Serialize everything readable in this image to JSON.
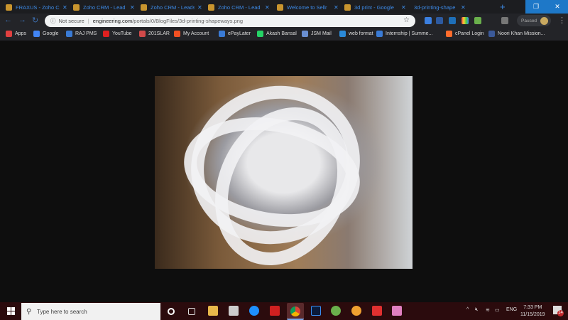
{
  "browser": {
    "tabs": [
      {
        "label": "FRAXUS - Zoho C",
        "icon": "fraxus-icon"
      },
      {
        "label": "Zoho CRM - Lead",
        "icon": "zoho-icon"
      },
      {
        "label": "Zoho CRM - Leads",
        "icon": "zoho-icon"
      },
      {
        "label": "Zoho CRM - Lead",
        "icon": "zoho-icon"
      },
      {
        "label": "Welcome to Sellr",
        "icon": "gmail-icon"
      },
      {
        "label": "3d print - Google",
        "icon": "google-icon"
      },
      {
        "label": "3d-printing-shape",
        "icon": "none",
        "active": true
      }
    ],
    "security": "Not secure",
    "url_domain": "engineering.com",
    "url_path": "/portals/0/BlogFiles/3d-printing-shapeways.png",
    "profile": "Paused",
    "bookmarks": [
      {
        "label": "Apps",
        "color": "#e04040"
      },
      {
        "label": "Google",
        "color": "#4285f4"
      },
      {
        "label": "RAJ PMS",
        "color": "#3a7bd5"
      },
      {
        "label": "YouTube",
        "color": "#e02020"
      },
      {
        "label": "201SLAR",
        "color": "#d04a4a"
      },
      {
        "label": "My Account",
        "color": "#f25022"
      },
      {
        "label": "ePayLater",
        "color": "#3a7bd5"
      },
      {
        "label": "Akash Bansal",
        "color": "#25d366"
      },
      {
        "label": "JSM Mail",
        "color": "#6a8fd0"
      },
      {
        "label": "web format",
        "color": "#2b8ad8"
      },
      {
        "label": "Internship | Summe...",
        "color": "#3a7bd5"
      },
      {
        "label": "cPanel Login",
        "color": "#ff6c2c"
      },
      {
        "label": "Noori Khan Mission...",
        "color": "#3b5998"
      }
    ]
  },
  "content": {
    "image": "3D printed white lattice sculpture"
  },
  "taskbar": {
    "search_placeholder": "Type here to search",
    "language": "ENG",
    "time": "7:33 PM",
    "date": "11/15/2019",
    "notifications": "14"
  }
}
